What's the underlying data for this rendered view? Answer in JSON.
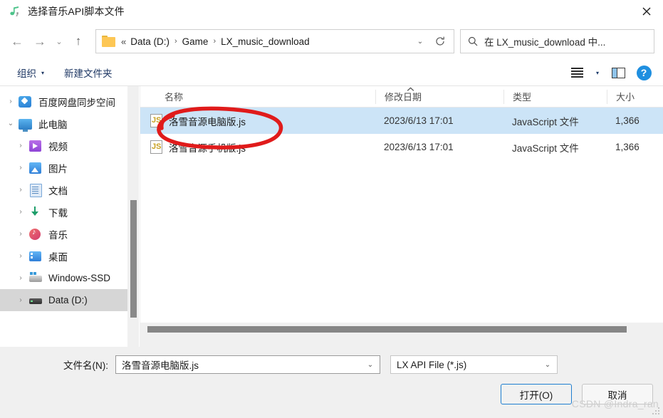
{
  "window": {
    "title": "选择音乐API脚本文件",
    "title_icon": "music-note-icon",
    "close_label": "✕"
  },
  "nav": {
    "back_icon": "←",
    "forward_icon": "→",
    "recent_icon": "⌄",
    "up_icon": "↑",
    "folder_icon": "folder-icon",
    "path_lead": "«",
    "breadcrumbs": [
      "Data (D:)",
      "Game",
      "LX_music_download"
    ],
    "separator": "›",
    "dropdown_icon": "⌄",
    "refresh_icon": "⟳"
  },
  "search": {
    "icon": "search-icon",
    "placeholder": "在 LX_music_download 中..."
  },
  "commandbar": {
    "organize_label": "组织",
    "organize_caret": "▾",
    "new_folder_label": "新建文件夹",
    "view_caret": "▾",
    "help_label": "?"
  },
  "sidebar": {
    "items": [
      {
        "label": "百度网盘同步空间",
        "icon": "baidu-netdisk-icon",
        "level": 1,
        "expander": "›",
        "selected": false
      },
      {
        "label": "此电脑",
        "icon": "this-pc-icon",
        "level": 1,
        "expander": "⌄",
        "selected": false
      },
      {
        "label": "视频",
        "icon": "videos-icon",
        "level": 2,
        "expander": "›",
        "selected": false
      },
      {
        "label": "图片",
        "icon": "pictures-icon",
        "level": 2,
        "expander": "›",
        "selected": false
      },
      {
        "label": "文档",
        "icon": "documents-icon",
        "level": 2,
        "expander": "›",
        "selected": false
      },
      {
        "label": "下载",
        "icon": "downloads-icon",
        "level": 2,
        "expander": "›",
        "selected": false
      },
      {
        "label": "音乐",
        "icon": "music-icon",
        "level": 2,
        "expander": "›",
        "selected": false
      },
      {
        "label": "桌面",
        "icon": "desktop-icon",
        "level": 2,
        "expander": "›",
        "selected": false
      },
      {
        "label": "Windows-SSD",
        "icon": "ssd-drive-icon",
        "level": 2,
        "expander": "›",
        "selected": false
      },
      {
        "label": "Data (D:)",
        "icon": "hard-drive-icon",
        "level": 2,
        "expander": "›",
        "selected": true
      }
    ]
  },
  "filelist": {
    "columns": [
      "名称",
      "修改日期",
      "类型",
      "大小"
    ],
    "sort_indicator": "︿",
    "rows": [
      {
        "name": "洛雪音源电脑版.js",
        "date": "2023/6/13 17:01",
        "type": "JavaScript 文件",
        "size": "1,366",
        "icon": "javascript-file-icon",
        "selected": true
      },
      {
        "name": "洛雪音源手机版.js",
        "date": "2023/6/13 17:01",
        "type": "JavaScript 文件",
        "size": "1,366",
        "icon": "javascript-file-icon",
        "selected": false
      }
    ]
  },
  "footer": {
    "filename_label": "文件名(N):",
    "filename_value": "洛雪音源电脑版.js",
    "filename_dropdown_icon": "⌄",
    "filetype_value": "LX API File (*.js)",
    "filetype_dropdown_icon": "⌄",
    "open_button": "打开(O)",
    "cancel_button": "取消"
  },
  "annotation": {
    "shape": "red-ellipse-highlight",
    "color": "#e01b1b"
  },
  "watermark": {
    "text": "CSDN @Indra_ran"
  }
}
